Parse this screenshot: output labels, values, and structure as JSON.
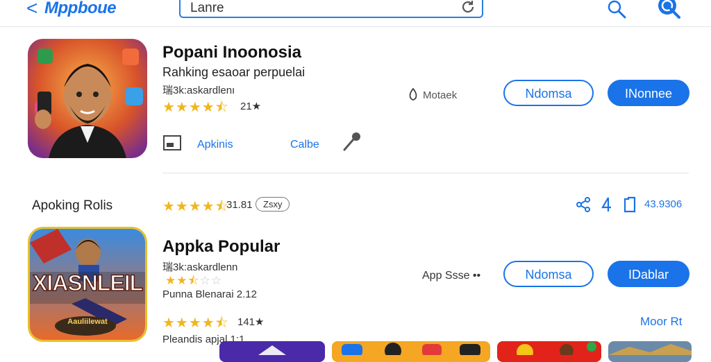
{
  "header": {
    "back_glyph": "<",
    "brand": "Mppboue",
    "search_value": "Lanre"
  },
  "app1": {
    "title": "Popani Inoonosia",
    "subtitle": "Rahking esaoar perpuelai",
    "developer": "瑞3k:askardlenı",
    "rating_text": "21★",
    "rating_stars": 4.5,
    "store_label": "Motaek",
    "link_apkinis": "Apkinis",
    "link_calbe": "Calbe",
    "btn_outline": "Ndomsa",
    "btn_primary": "INonnee"
  },
  "section": {
    "title": "Apoking Rolis",
    "rating_text": "31.81",
    "pill": "Zsxy",
    "count": "43.9306",
    "rating_stars": 4.5
  },
  "app2": {
    "title": "Appka Popular",
    "developer": "瑞3k:askardlenn",
    "rating_stars_small": 2.5,
    "meta": "Punna Blenarai 2.12",
    "rating_text": "141★",
    "rating_stars": 4.5,
    "footer": "Pleandis apjal 1:1",
    "store_label": "App Ssse ••",
    "btn_outline": "Ndomsa",
    "btn_primary": "IDablar",
    "more_link": "Moor Rt",
    "icon_text": "XIASNLEIL",
    "icon_subtext": "Aauliilewat"
  },
  "icons": {
    "back": "chevron-left-icon",
    "refresh": "refresh-icon",
    "search": "search-icon",
    "share": "share-icon",
    "download": "download-icon",
    "bookmark": "bookmark-icon",
    "mic": "mic-icon",
    "screen": "screen-icon",
    "store": "store-icon"
  },
  "colors": {
    "accent": "#1a73e8",
    "star": "#f0b61d"
  }
}
